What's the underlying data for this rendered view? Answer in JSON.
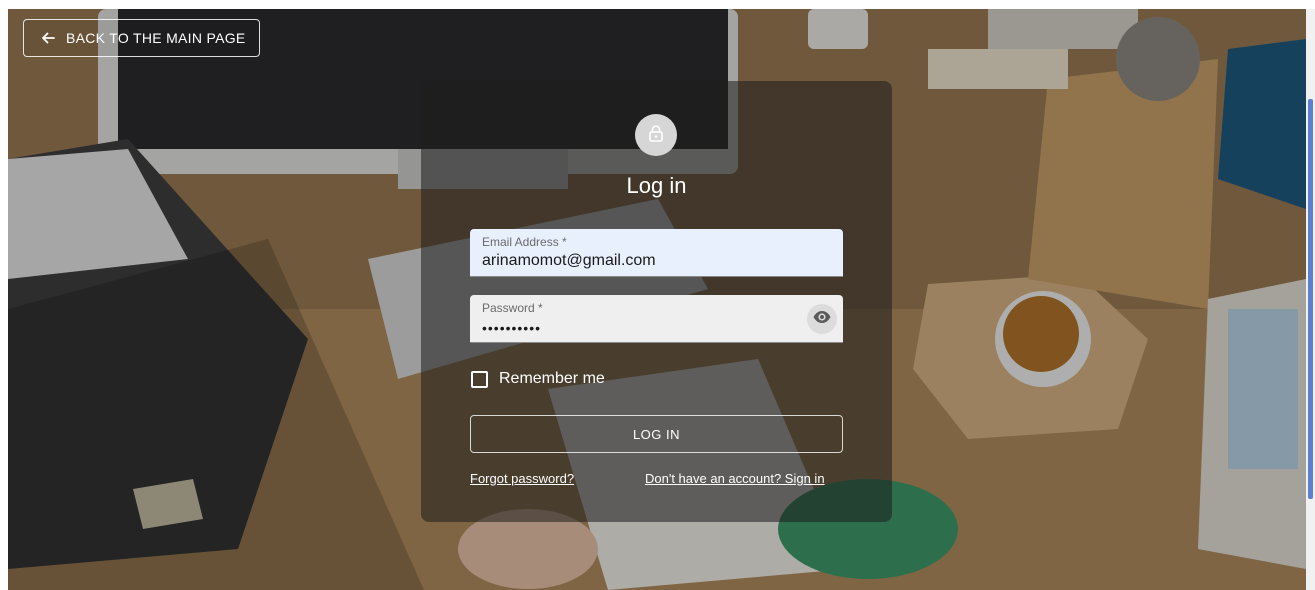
{
  "header": {
    "back_label": "BACK TO THE MAIN PAGE",
    "back_icon": "arrow-left-icon"
  },
  "card": {
    "icon": "lock-icon",
    "title": "Log in"
  },
  "form": {
    "email": {
      "label": "Email Address *",
      "value": "arinamomot@gmail.com"
    },
    "password": {
      "label": "Password *",
      "value": "••••••••••",
      "toggle_icon": "eye-icon"
    },
    "remember_label": "Remember me",
    "remember_checked": false,
    "submit_label": "LOG IN"
  },
  "links": {
    "forgot": "Forgot password?",
    "signup": "Don't have an account? Sign in"
  },
  "colors": {
    "email_field_bg": "#e8f0fe",
    "password_field_bg": "#efefef",
    "card_overlay": "rgba(30,30,30,0.55)",
    "text_light": "#ffffff"
  }
}
